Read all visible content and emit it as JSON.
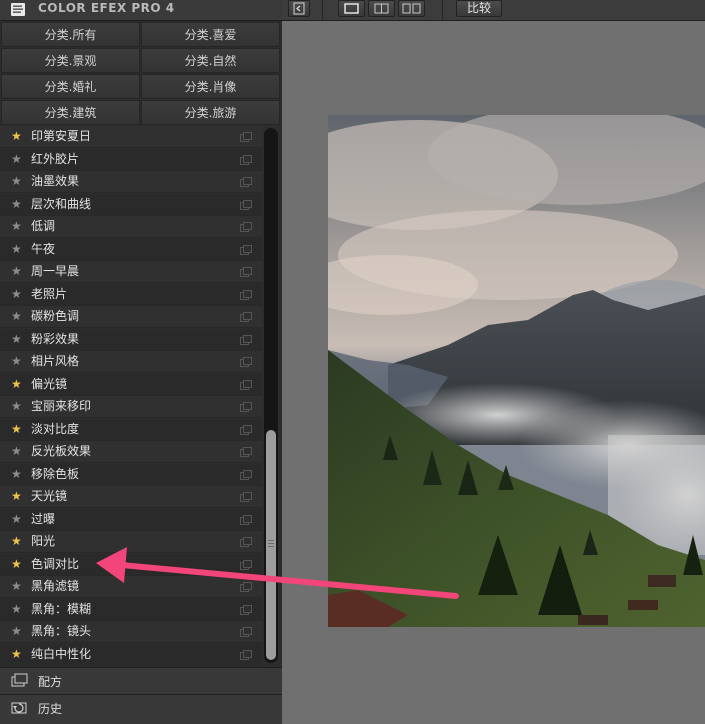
{
  "app": {
    "title": "COLOR EFEX PRO 4"
  },
  "categories": [
    {
      "label": "分类.所有"
    },
    {
      "label": "分类.喜爱"
    },
    {
      "label": "分类.景观"
    },
    {
      "label": "分类.自然"
    },
    {
      "label": "分类.婚礼"
    },
    {
      "label": "分类.肖像"
    },
    {
      "label": "分类.建筑"
    },
    {
      "label": "分类.旅游"
    }
  ],
  "filters": [
    {
      "label": "印第安夏日",
      "favorite": true
    },
    {
      "label": "红外胶片",
      "favorite": false
    },
    {
      "label": "油墨效果",
      "favorite": false
    },
    {
      "label": "层次和曲线",
      "favorite": false
    },
    {
      "label": "低调",
      "favorite": false
    },
    {
      "label": "午夜",
      "favorite": false
    },
    {
      "label": "周一早晨",
      "favorite": false
    },
    {
      "label": "老照片",
      "favorite": false
    },
    {
      "label": "碳粉色调",
      "favorite": false
    },
    {
      "label": "粉彩效果",
      "favorite": false
    },
    {
      "label": "相片风格",
      "favorite": false
    },
    {
      "label": "偏光镜",
      "favorite": true
    },
    {
      "label": "宝丽来移印",
      "favorite": false
    },
    {
      "label": "淡对比度",
      "favorite": true
    },
    {
      "label": "反光板效果",
      "favorite": false
    },
    {
      "label": "移除色板",
      "favorite": false
    },
    {
      "label": "天光镜",
      "favorite": true
    },
    {
      "label": "过曝",
      "favorite": false
    },
    {
      "label": "阳光",
      "favorite": true
    },
    {
      "label": "色调对比",
      "favorite": true
    },
    {
      "label": "黑角滤镜",
      "favorite": false
    },
    {
      "label": "黑角：模糊",
      "favorite": false
    },
    {
      "label": "黑角：镜头",
      "favorite": false
    },
    {
      "label": "纯白中性化",
      "favorite": true
    }
  ],
  "star_glyph": "★",
  "star_on_color": "#f0c24a",
  "star_off_color": "#8d8d8d",
  "bottom": {
    "recipes_label": "配方",
    "history_label": "历史"
  },
  "toolbar": {
    "compare_label": "比较"
  },
  "annotation": {
    "arrow_color": "#f2457a",
    "points_to": "色调对比"
  }
}
